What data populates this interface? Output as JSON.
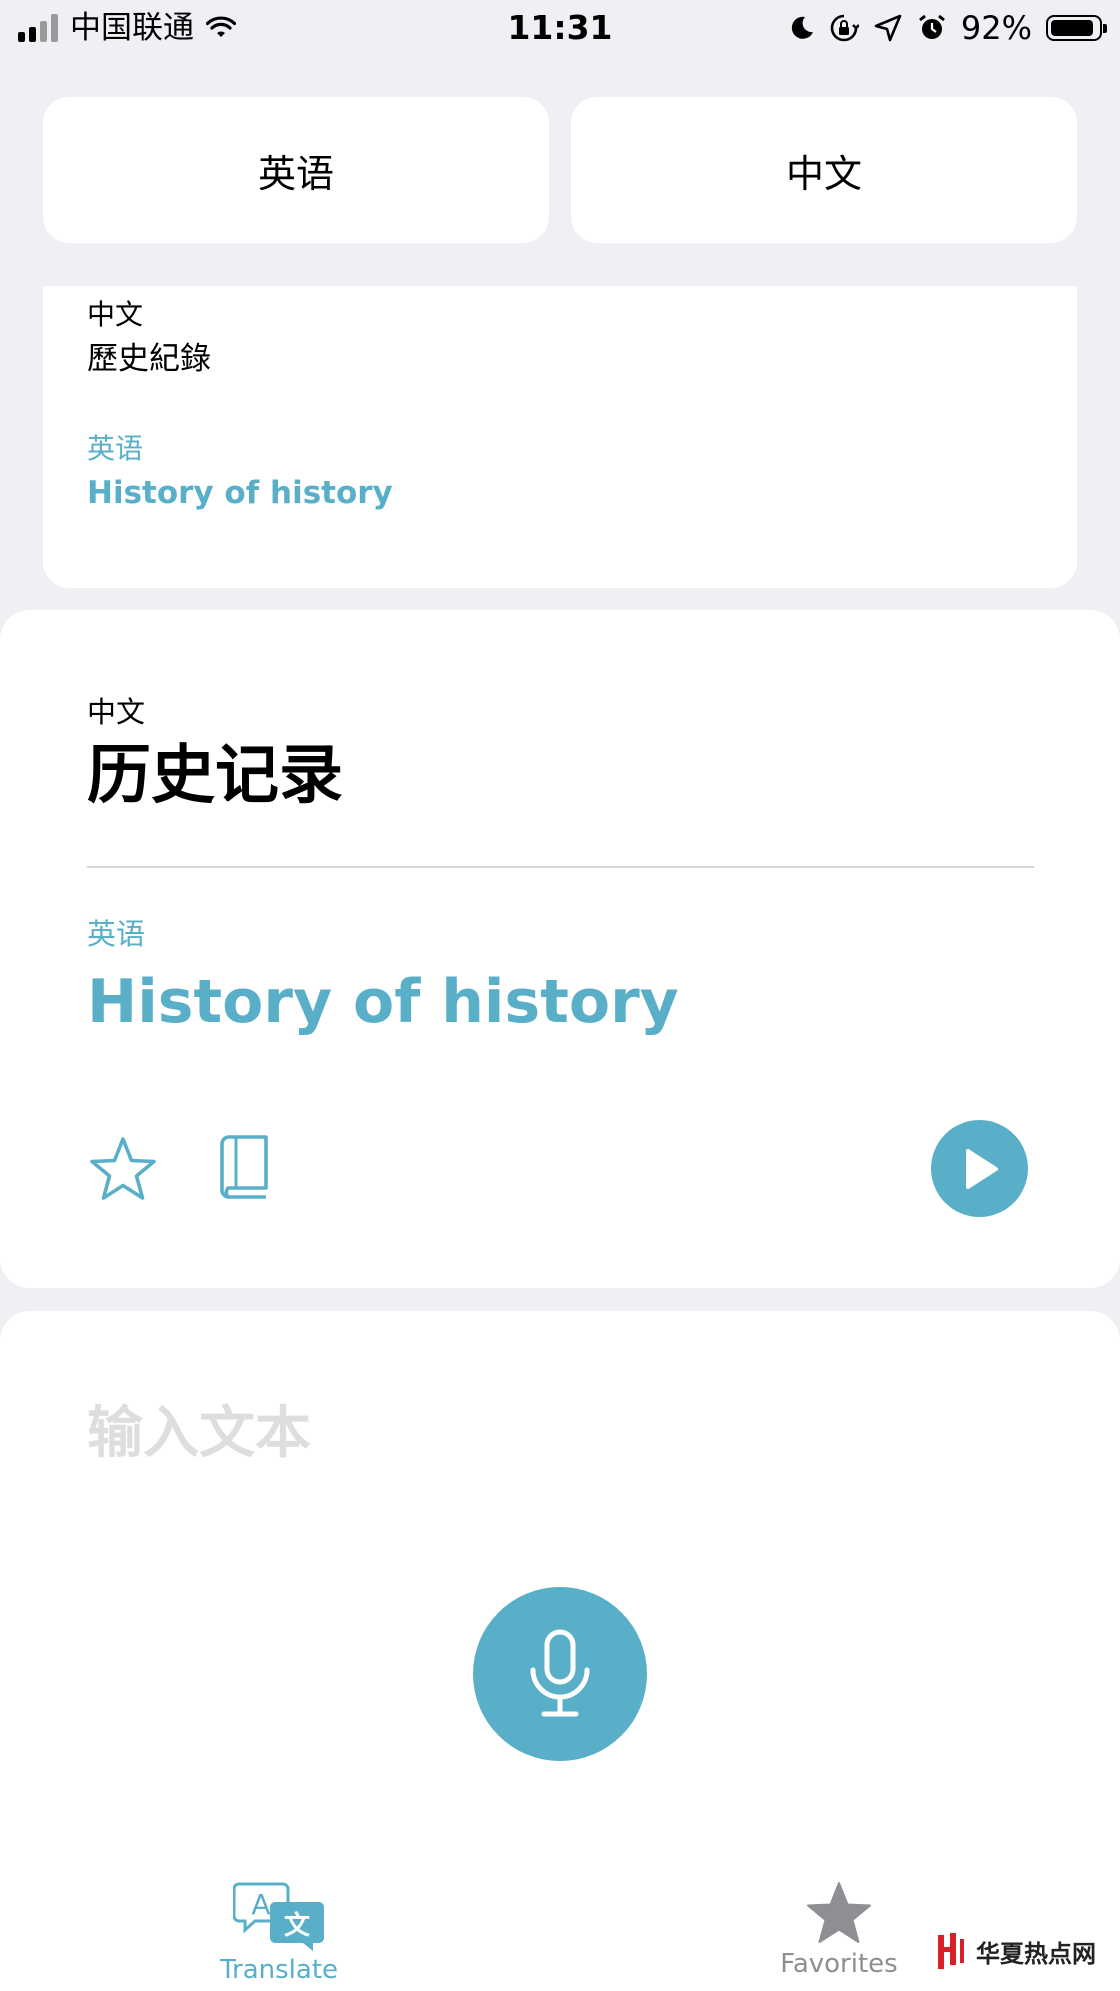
{
  "status_bar": {
    "carrier": "中国联通",
    "time": "11:31",
    "battery_percent": "92%",
    "battery_level": 0.92,
    "icons": [
      "signal-icon",
      "wifi-icon",
      "moon-icon",
      "rotation-lock-icon",
      "location-icon",
      "alarm-icon",
      "battery-icon"
    ]
  },
  "languages": {
    "source": "英语",
    "target": "中文"
  },
  "history": {
    "source_label": "中文",
    "source_text": "歷史紀錄",
    "target_label": "英语",
    "target_text": "History of history"
  },
  "result": {
    "source_label": "中文",
    "source_text": "历史记录",
    "target_label": "英语",
    "target_text": "History of history",
    "actions": [
      "star-icon",
      "dictionary-book-icon",
      "play-icon"
    ]
  },
  "input": {
    "placeholder": "输入文本",
    "value": "",
    "mic_icon": "microphone-icon"
  },
  "tabs": [
    {
      "label": "Translate",
      "icon": "translate-icon",
      "active": true
    },
    {
      "label": "Favorites",
      "icon": "star-filled-icon",
      "active": false
    }
  ],
  "watermark": {
    "text": "华夏热点网"
  },
  "colors": {
    "accent": "#5aafc8",
    "background": "#efeff4",
    "card": "#ffffff",
    "placeholder": "#dedede",
    "inactive_tab": "#8e8e93"
  }
}
